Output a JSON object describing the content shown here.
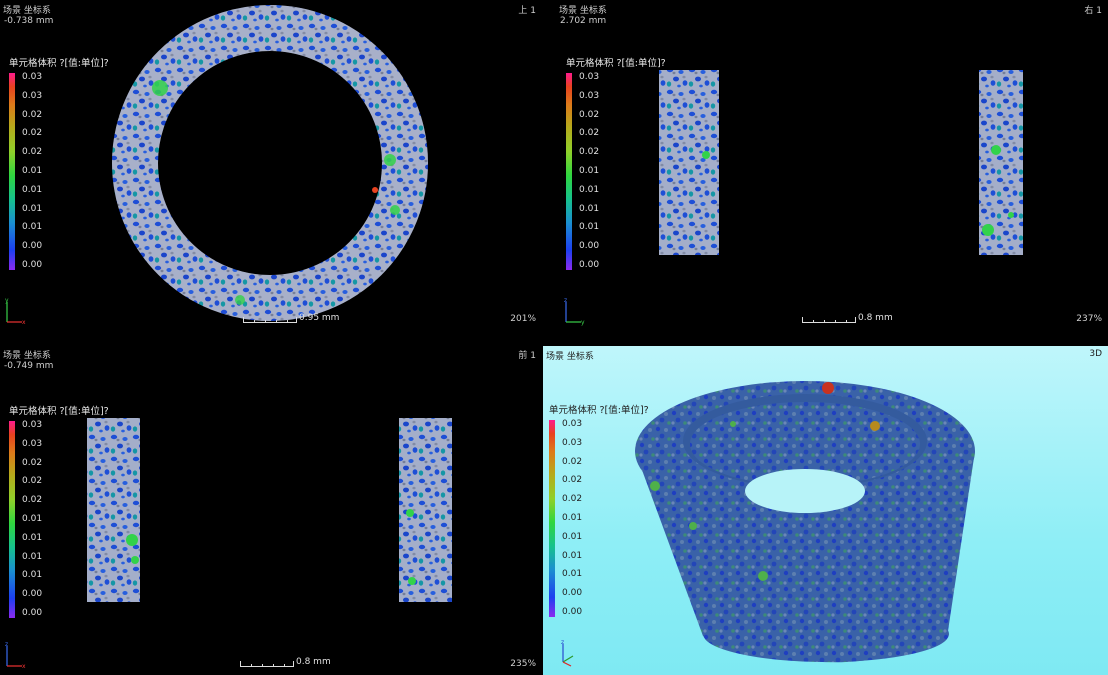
{
  "colors": {
    "particle_blue": "#1f4fd6",
    "particle_gray": "#c4c4c4",
    "particle_teal": "#13a89a",
    "particle_green": "#32d24a",
    "background_3d": "#8eeef6"
  },
  "views": {
    "top_left": {
      "title": "场景 坐标系",
      "position": "-0.738 mm",
      "name": "上 1",
      "legend_title": "单元格体积 ?[值:单位]?",
      "ticks": [
        "0.03",
        "0.03",
        "0.02",
        "0.02",
        "0.02",
        "0.01",
        "0.01",
        "0.01",
        "0.01",
        "0.00",
        "0.00"
      ],
      "scale_label": "0.95 mm",
      "zoom": "201%"
    },
    "top_right": {
      "title": "场景 坐标系",
      "position": "2.702 mm",
      "name": "右 1",
      "legend_title": "单元格体积 ?[值:单位]?",
      "ticks": [
        "0.03",
        "0.03",
        "0.02",
        "0.02",
        "0.02",
        "0.01",
        "0.01",
        "0.01",
        "0.01",
        "0.00",
        "0.00"
      ],
      "scale_label": "0.8 mm",
      "zoom": "237%"
    },
    "bottom_left": {
      "title": "场景 坐标系",
      "position": "-0.749 mm",
      "name": "前 1",
      "legend_title": "单元格体积 ?[值:单位]?",
      "ticks": [
        "0.03",
        "0.03",
        "0.02",
        "0.02",
        "0.02",
        "0.01",
        "0.01",
        "0.01",
        "0.01",
        "0.00",
        "0.00"
      ],
      "scale_label": "0.8 mm",
      "zoom": "235%"
    },
    "bottom_right": {
      "title": "场景 坐标系",
      "name": "3D",
      "legend_title": "单元格体积 ?[值:单位]?",
      "ticks": [
        "0.03",
        "0.03",
        "0.02",
        "0.02",
        "0.02",
        "0.01",
        "0.01",
        "0.01",
        "0.01",
        "0.00",
        "0.00"
      ]
    }
  }
}
